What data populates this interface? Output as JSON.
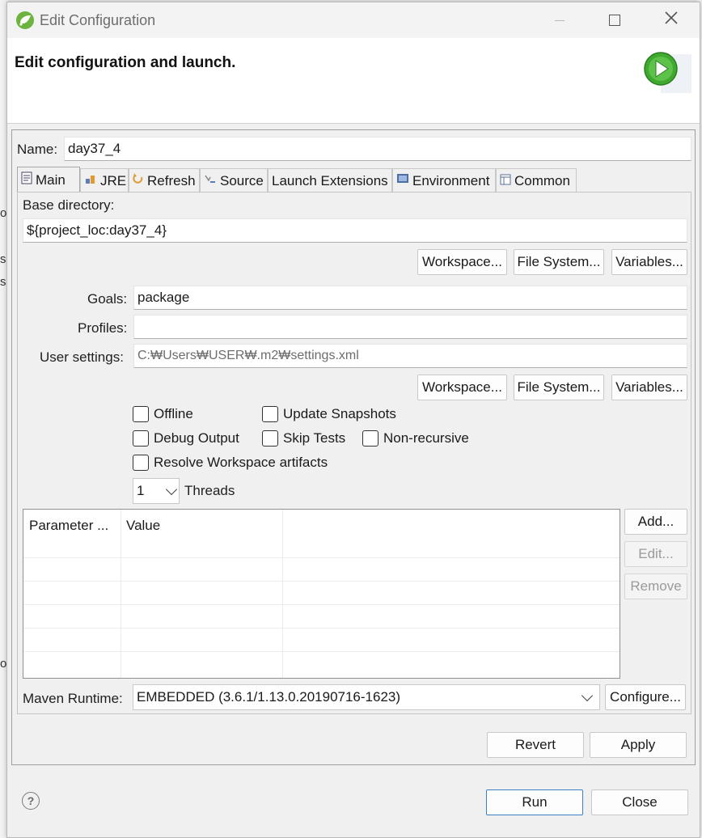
{
  "window": {
    "title": "Edit Configuration",
    "header_title": "Edit configuration and launch."
  },
  "name": {
    "label": "Name:",
    "value": "day37_4"
  },
  "tabs": [
    {
      "label": "Main",
      "icon": "main-tab-icon"
    },
    {
      "label": "JRE",
      "icon": "jre-icon"
    },
    {
      "label": "Refresh",
      "icon": "refresh-icon"
    },
    {
      "label": "Source",
      "icon": "source-icon"
    },
    {
      "label": "Launch Extensions",
      "icon": ""
    },
    {
      "label": "Environment",
      "icon": "environment-icon"
    },
    {
      "label": "Common",
      "icon": "common-icon"
    }
  ],
  "main": {
    "base_dir_label": "Base directory:",
    "base_dir_value": "${project_loc:day37_4}",
    "workspace_label": "Workspace...",
    "filesystem_label": "File System...",
    "variables_label": "Variables...",
    "goals_label": "Goals:",
    "goals_value": "package",
    "profiles_label": "Profiles:",
    "profiles_value": "",
    "user_settings_label": "User settings:",
    "user_settings_value": "C:₩Users₩USER₩.m2₩settings.xml",
    "checkboxes": {
      "offline": "Offline",
      "update_snapshots": "Update Snapshots",
      "debug_output": "Debug Output",
      "skip_tests": "Skip Tests",
      "non_recursive": "Non-recursive",
      "resolve_workspace": "Resolve Workspace artifacts"
    },
    "threads_value": "1",
    "threads_label": "Threads",
    "table": {
      "col_param": "Parameter ...",
      "col_value": "Value"
    },
    "add_label": "Add...",
    "edit_label": "Edit...",
    "remove_label": "Remove",
    "runtime_label": "Maven Runtime:",
    "runtime_value": "EMBEDDED (3.6.1/1.13.0.20190716-1623)",
    "configure_label": "Configure..."
  },
  "footer": {
    "revert_label": "Revert",
    "apply_label": "Apply",
    "run_label": "Run",
    "close_label": "Close",
    "help_symbol": "?"
  },
  "background": {
    "left_fragments": [
      "ot",
      "s",
      "s",
      "o"
    ]
  },
  "colors": {
    "accent_border": "#3c7fc7",
    "run_icon_green": "#3faa2f"
  }
}
